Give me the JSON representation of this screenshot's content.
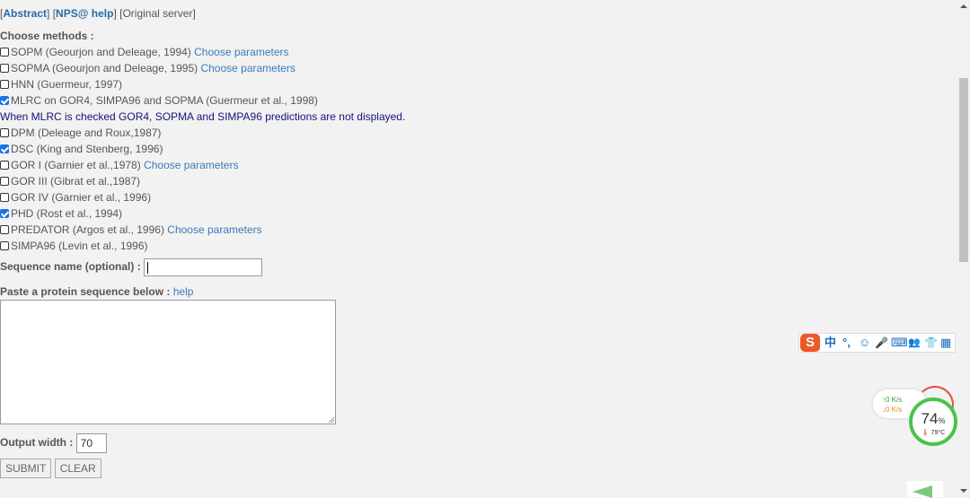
{
  "topnav": {
    "open1": "[",
    "abstract": "Abstract",
    "sep1": "] [",
    "nps_help": "NPS@ help",
    "sep2": "] [",
    "original": "Original server",
    "close": "]"
  },
  "methods_heading": "Choose methods :",
  "methods": [
    {
      "label": "SOPM (Geourjon and Deleage, 1994)",
      "checked": false,
      "link": "Choose parameters"
    },
    {
      "label": "SOPMA (Geourjon and Deleage, 1995)",
      "checked": false,
      "link": "Choose parameters"
    },
    {
      "label": "HNN (Guermeur, 1997)",
      "checked": false,
      "link": ""
    },
    {
      "label": "MLRC on GOR4, SIMPA96 and SOPMA (Guermeur et al., 1998)",
      "checked": true,
      "link": ""
    },
    {
      "label": "DPM (Deleage and Roux,1987)",
      "checked": false,
      "link": ""
    },
    {
      "label": "DSC (King and Stenberg, 1996)",
      "checked": true,
      "link": ""
    },
    {
      "label": "GOR I (Garnier et al.,1978)",
      "checked": false,
      "link": "Choose parameters"
    },
    {
      "label": "GOR III (Gibrat et al.,1987)",
      "checked": false,
      "link": ""
    },
    {
      "label": "GOR IV (Garnier et al., 1996)",
      "checked": false,
      "link": ""
    },
    {
      "label": "PHD (Rost et al., 1994)",
      "checked": true,
      "link": ""
    },
    {
      "label": "PREDATOR (Argos et al., 1996)",
      "checked": false,
      "link": "Choose parameters"
    },
    {
      "label": "SIMPA96 (Levin et al., 1996)",
      "checked": false,
      "link": ""
    }
  ],
  "mlrc_note": "When MLRC is checked GOR4, SOPMA and SIMPA96 predictions are not displayed.",
  "sequence_name_label": "Sequence name (optional) :",
  "sequence_name_value": "",
  "paste_label": "Paste a protein sequence below :",
  "paste_help": "help",
  "sequence_value": "",
  "output_width_label": "Output width :",
  "output_width_value": "70",
  "submit_label": "SUBMIT",
  "clear_label": "CLEAR",
  "ime_toolbar": {
    "logo": "S",
    "items": [
      "中",
      "°,",
      "☺",
      "🎤",
      "⌨",
      "👥",
      "👕",
      "▦"
    ]
  },
  "net_widget": {
    "up_rate": "↑0  K/s",
    "down_rate": "↓0  K/s",
    "cpu_percent": "74",
    "cpu_unit": "%",
    "temperature": "79°C"
  }
}
